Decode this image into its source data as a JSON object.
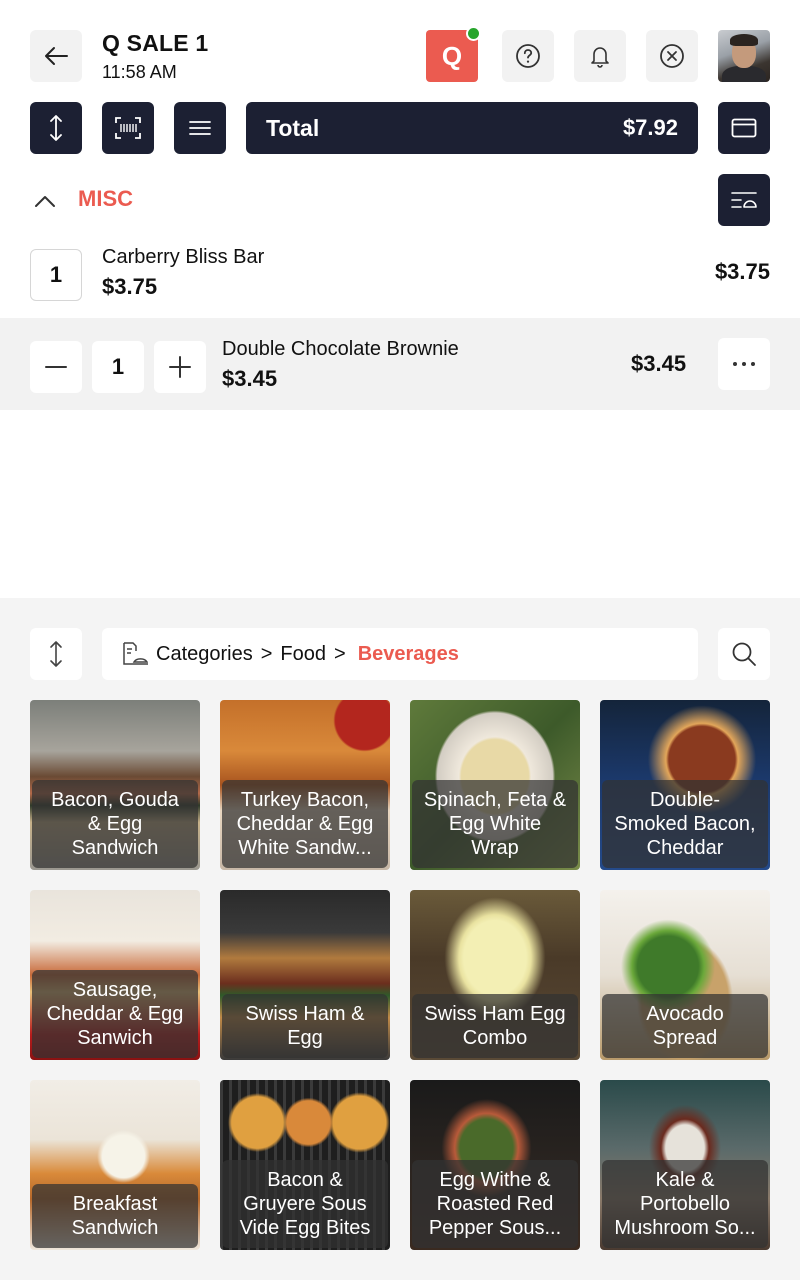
{
  "header": {
    "title": "Q SALE 1",
    "time": "11:58 AM",
    "q_badge": "Q",
    "status_color": "#27a52c",
    "accent_color": "#eb5b50"
  },
  "toolbar": {
    "total_label": "Total",
    "total_value": "$7.92"
  },
  "section": {
    "label": "MISC"
  },
  "cart": {
    "items": [
      {
        "qty": "1",
        "name": "Carberry Bliss Bar",
        "price": "$3.75",
        "line_total": "$3.75"
      },
      {
        "qty": "1",
        "name": "Double Chocolate Brownie",
        "price": "$3.45",
        "line_total": "$3.45"
      }
    ]
  },
  "breadcrumb": {
    "root": "Categories",
    "sep": ">",
    "parent": "Food",
    "current": "Beverages"
  },
  "products": [
    {
      "name": "Bacon, Gouda\n& Egg\nSandwich"
    },
    {
      "name": "Turkey Bacon,\nCheddar & Egg\nWhite Sandw..."
    },
    {
      "name": "Spinach, Feta &\nEgg White\nWrap"
    },
    {
      "name": "Double-\nSmoked Bacon,\nCheddar"
    },
    {
      "name": "Sausage,\nCheddar & Egg\nSanwich"
    },
    {
      "name": "Swiss Ham &\nEgg"
    },
    {
      "name": "Swiss Ham Egg\nCombo"
    },
    {
      "name": "Avocado\nSpread"
    },
    {
      "name": "Breakfast\nSandwich"
    },
    {
      "name": "Bacon &\nGruyere Sous\nVide Egg Bites"
    },
    {
      "name": "Egg Withe &\nRoasted Red\nPepper Sous..."
    },
    {
      "name": "Kale &\nPortobello\nMushroom So..."
    }
  ]
}
